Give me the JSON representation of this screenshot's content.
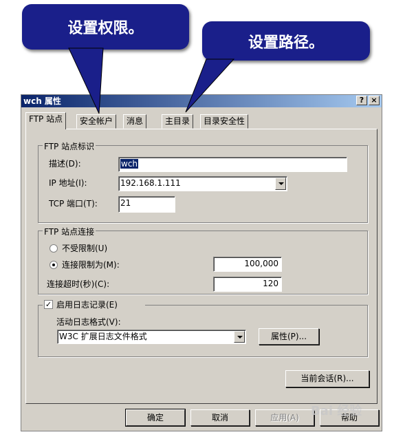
{
  "callouts": {
    "permissions": "设置权限。",
    "path": "设置路径。"
  },
  "window": {
    "title": "wch 属性",
    "help_glyph": "?",
    "close_glyph": "×"
  },
  "tabs": [
    {
      "label": "FTP 站点",
      "active": true
    },
    {
      "label": "安全帐户",
      "active": false
    },
    {
      "label": "消息",
      "active": false
    },
    {
      "label": "主目录",
      "active": false
    },
    {
      "label": "目录安全性",
      "active": false
    }
  ],
  "site_id": {
    "legend": "FTP 站点标识",
    "description_label": "描述(D):",
    "description_value": "wch",
    "ip_label": "IP 地址(I):",
    "ip_value": "192.168.1.111",
    "port_label": "TCP 端口(T):",
    "port_value": "21"
  },
  "connections": {
    "legend": "FTP 站点连接",
    "unlimited_label": "不受限制(U)",
    "limited_label": "连接限制为(M):",
    "limited_value": "100,000",
    "limited_selected": true,
    "timeout_label": "连接超时(秒)(C):",
    "timeout_value": "120"
  },
  "logging": {
    "enable_label": "启用日志记录(E)",
    "enabled": true,
    "format_label": "活动日志格式(V):",
    "format_value": "W3C 扩展日志文件格式",
    "properties_button": "属性(P)..."
  },
  "current_sessions_button": "当前会话(R)...",
  "footer": {
    "ok": "确定",
    "cancel": "取消",
    "apply": "应用(A)",
    "help": "帮助"
  },
  "watermark": "Bai 经验",
  "colors": {
    "callout_bg": "#1a1f8a",
    "titlebar_start": "#0a246a",
    "titlebar_end": "#a6caf0",
    "dialog_bg": "#d4d0c8"
  }
}
